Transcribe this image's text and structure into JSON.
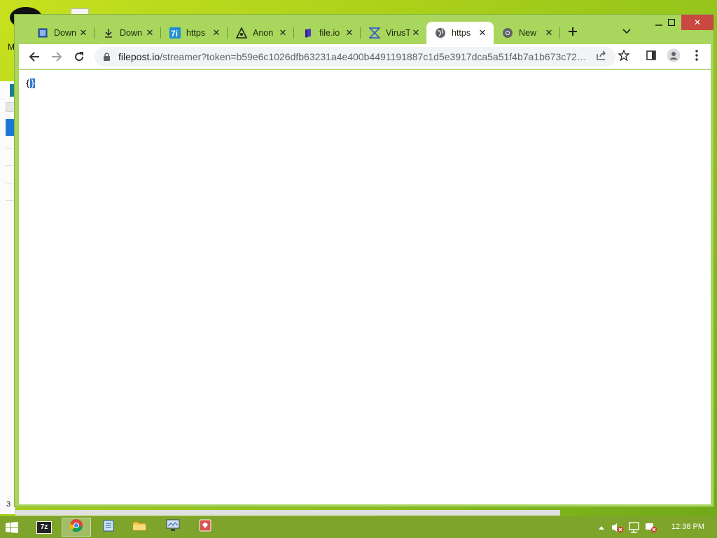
{
  "browser": {
    "tabs": [
      {
        "title": "Down",
        "icon": "notepad-icon"
      },
      {
        "title": "Down",
        "icon": "download-icon"
      },
      {
        "title": "https",
        "icon": "7i-icon"
      },
      {
        "title": "Anon",
        "icon": "anon-icon"
      },
      {
        "title": "file.io",
        "icon": "fileio-icon"
      },
      {
        "title": "VirusT",
        "icon": "virustotal-icon"
      },
      {
        "title": "https",
        "icon": "globe-icon",
        "active": true
      },
      {
        "title": "New",
        "icon": "chrome-icon"
      }
    ],
    "url": {
      "host": "filepost.io",
      "path": "/streamer?token=b59e6c1026dfb63231a4e400b4491191887c1d5e3917dca5a51f4b7a1b673c72%..."
    },
    "page": {
      "open": "{",
      "close": "}"
    }
  },
  "background": {
    "letter": "M",
    "number": "3"
  },
  "taskbar": {
    "clock": "12:38 PM",
    "items": [
      {
        "name": "7zip",
        "icon": "7zip-icon",
        "label": "7z"
      },
      {
        "name": "chrome",
        "icon": "chrome-icon",
        "active": true
      },
      {
        "name": "notepad",
        "icon": "notepad-icon"
      },
      {
        "name": "explorer",
        "icon": "folder-icon"
      },
      {
        "name": "monitor",
        "icon": "monitor-icon"
      },
      {
        "name": "app",
        "icon": "app-icon"
      }
    ]
  }
}
